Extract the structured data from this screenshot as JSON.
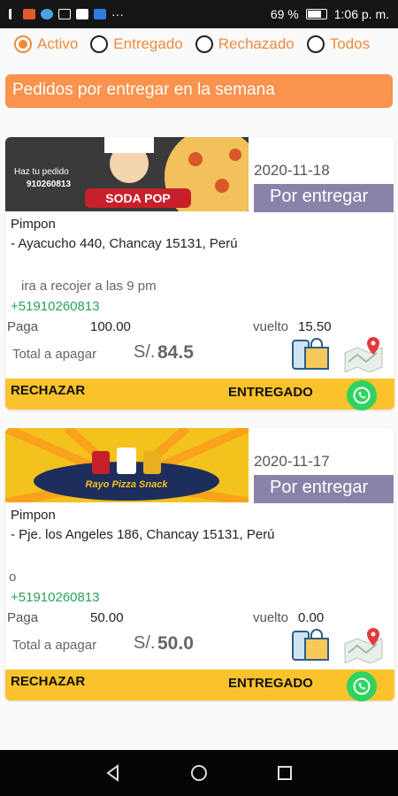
{
  "status_bar": {
    "battery": "69 %",
    "time": "1:06 p. m."
  },
  "filters": [
    {
      "label": "Activo",
      "selected": true
    },
    {
      "label": "Entregado",
      "selected": false
    },
    {
      "label": "Rechazado",
      "selected": false
    },
    {
      "label": "Todos",
      "selected": false
    }
  ],
  "banner": "Pedidos por entregar en la semana",
  "orders": [
    {
      "brand_text": "SODA POP",
      "promo_text": "Haz tu pedido",
      "promo_phone": "910260813",
      "date": "2020-11-18",
      "status": "Por entregar",
      "customer": "Pimpon",
      "address": "- Ayacucho 440, Chancay 15131, Perú",
      "note": "ira a recojer a las 9 pm",
      "phone": "+51910260813",
      "paga_label": "Paga",
      "paga": "100.00",
      "vuelto_label": "vuelto",
      "vuelto": "15.50",
      "total_label": "Total a apagar",
      "currency": "S/.",
      "total": "84.5",
      "reject": "RECHAZAR",
      "deliver": "ENTREGADO"
    },
    {
      "brand_text": "Rayo Pizza Snack",
      "date": "2020-11-17",
      "status": "Por entregar",
      "customer": "Pimpon",
      "address": "- Pje. los Angeles 186, Chancay 15131, Perú",
      "note": "o",
      "phone": "+51910260813",
      "paga_label": "Paga",
      "paga": "50.00",
      "vuelto_label": "vuelto",
      "vuelto": "0.00",
      "total_label": "Total a apagar",
      "currency": "S/.",
      "total": "50.0",
      "reject": "RECHAZAR",
      "deliver": "ENTREGADO"
    }
  ],
  "colors": {
    "accent": "#f08a3c",
    "status": "#8b82a9",
    "actions": "#fbc32b",
    "whatsapp": "#2fd35f",
    "phone": "#27a35a"
  }
}
